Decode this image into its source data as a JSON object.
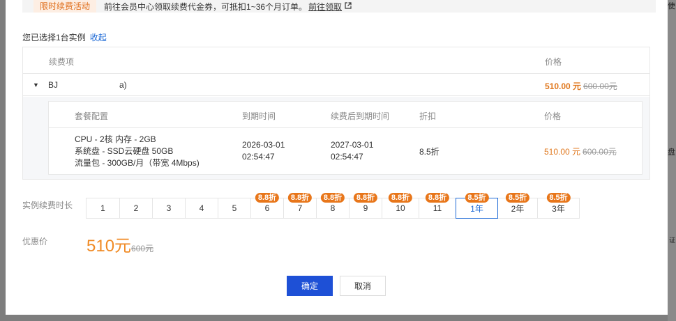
{
  "background": {
    "side_texts": [
      "使",
      "盘",
      "证"
    ]
  },
  "promo": {
    "tag": "限时续费活动",
    "text": "前往会员中心领取续费代金券，可抵扣1~36个月订单。",
    "link": "前往领取",
    "link_icon": "external-link-icon"
  },
  "selection": {
    "text": "您已选择1台实例",
    "toggle": "收起"
  },
  "outer_table": {
    "headers": [
      "续费项",
      "价格"
    ],
    "row": {
      "name_prefix": "BJ",
      "name_suffix": "a)",
      "price_now": "510.00 元",
      "price_old": "600.00元"
    }
  },
  "inner_table": {
    "headers": [
      "套餐配置",
      "到期时间",
      "续费后到期时间",
      "折扣",
      "价格"
    ],
    "row": {
      "config": [
        "CPU - 2核 内存 - 2GB",
        "系统盘 - SSD云硬盘 50GB",
        "流量包 - 300GB/月（带宽 4Mbps)"
      ],
      "expire": [
        "2026-03-01",
        "02:54:47"
      ],
      "new_expire": [
        "2027-03-01",
        "02:54:47"
      ],
      "discount": "8.5折",
      "price_now": "510.00 元",
      "price_old": "600.00元"
    }
  },
  "duration": {
    "label": "实例续费时长",
    "selected": "1年",
    "options": [
      {
        "label": "1",
        "badge": ""
      },
      {
        "label": "2",
        "badge": ""
      },
      {
        "label": "3",
        "badge": ""
      },
      {
        "label": "4",
        "badge": ""
      },
      {
        "label": "5",
        "badge": ""
      },
      {
        "label": "6",
        "badge": "8.8折"
      },
      {
        "label": "7",
        "badge": "8.8折"
      },
      {
        "label": "8",
        "badge": "8.8折"
      },
      {
        "label": "9",
        "badge": "8.8折"
      },
      {
        "label": "10",
        "badge": "8.8折"
      },
      {
        "label": "11",
        "badge": "8.8折"
      },
      {
        "label": "1年",
        "badge": "8.5折"
      },
      {
        "label": "2年",
        "badge": "8.5折"
      },
      {
        "label": "3年",
        "badge": "8.5折"
      }
    ]
  },
  "discount_price": {
    "label": "优惠价",
    "now": "510元",
    "old": "600元"
  },
  "actions": {
    "ok": "确定",
    "cancel": "取消"
  },
  "colors": {
    "accent": "#1e50d6",
    "orange": "#e8761a",
    "link": "#1e6ad6"
  }
}
